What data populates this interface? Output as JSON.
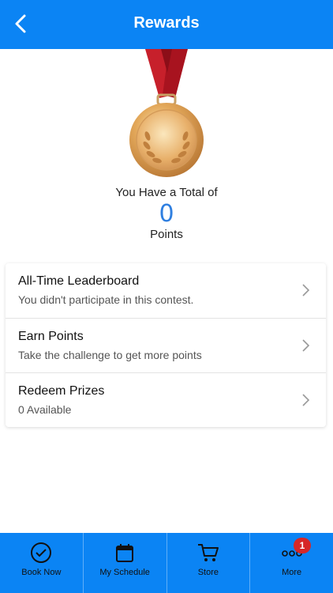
{
  "header": {
    "title": "Rewards",
    "back_icon": "chevron-left-icon"
  },
  "summary": {
    "total_text": "You Have a Total of",
    "points_value": "0",
    "points_label": "Points"
  },
  "colors": {
    "brand_blue": "#0b84f4",
    "points_blue": "#2f7fe0",
    "badge_red": "#d62828"
  },
  "menu": [
    {
      "title": "All-Time Leaderboard",
      "subtitle": "You didn't participate in this contest."
    },
    {
      "title": "Earn Points",
      "subtitle": "Take the challenge to get more points"
    },
    {
      "title": "Redeem Prizes",
      "subtitle": "0 Available"
    }
  ],
  "tabs": [
    {
      "label": "Book Now",
      "icon": "check-circle-icon"
    },
    {
      "label": "My Schedule",
      "icon": "calendar-icon"
    },
    {
      "label": "Store",
      "icon": "cart-icon"
    },
    {
      "label": "More",
      "icon": "more-dots-icon",
      "badge": "1"
    }
  ]
}
